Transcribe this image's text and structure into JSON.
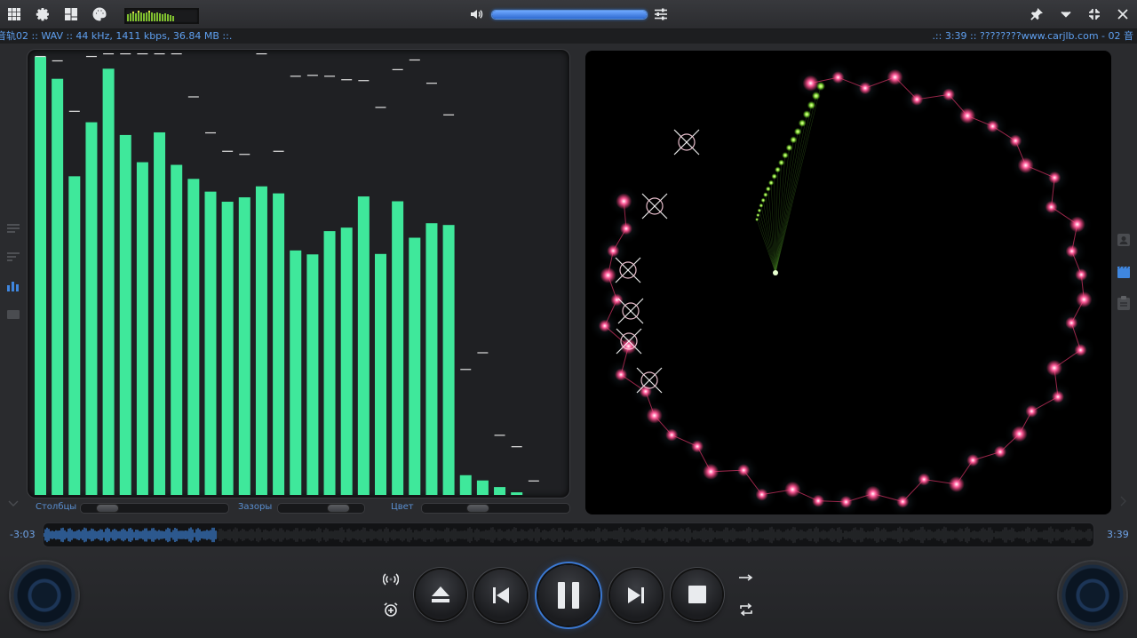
{
  "colors": {
    "accent": "#4a90e8",
    "spectrum_bar": "#3fe89b",
    "peak_marker": "#e0e0e0",
    "viz_ring": "#ff3d7a",
    "viz_tail": "#8be33c"
  },
  "toolbar": {
    "left_icons": [
      "apps-grid-icon",
      "settings-gear-icon",
      "layout-windows-icon",
      "palette-icon"
    ],
    "right_icons": [
      "pin-icon",
      "chevron-down-icon",
      "compact-mode-icon",
      "close-icon"
    ],
    "volume_level": 1.0
  },
  "info": {
    "left": "音轨02 :: WAV :: 44 kHz, 1411 kbps, 36.84 MB ::.",
    "right": ".:: 3:39 :: ????????www.carjlb.com - 02 音"
  },
  "spectrum": {
    "bars": [
      0.998,
      0.948,
      0.726,
      0.849,
      0.971,
      0.82,
      0.758,
      0.826,
      0.752,
      0.72,
      0.691,
      0.668,
      0.678,
      0.703,
      0.687,
      0.557,
      0.548,
      0.601,
      0.609,
      0.68,
      0.549,
      0.669,
      0.586,
      0.619,
      0.615,
      0.045,
      0.033,
      0.018,
      0.006
    ],
    "peaks": [
      0.992,
      0.982,
      0.867,
      0.992,
      0.998,
      0.998,
      0.998,
      0.998,
      0.998,
      0.9,
      0.818,
      0.776,
      0.769,
      0.998,
      0.776,
      0.947,
      0.949,
      0.947,
      0.939,
      0.937,
      0.876,
      0.962,
      0.984,
      0.931,
      0.859,
      0.279,
      0.317,
      0.129,
      0.103,
      0.025
    ]
  },
  "sliders": [
    {
      "label": "Столбцы",
      "value": 0.12
    },
    {
      "label": "Зазоры",
      "value": 0.78
    },
    {
      "label": "Цвет",
      "value": 0.36
    }
  ],
  "side_icons_left": [
    "playlist-icon",
    "queue-icon",
    "equalizer-icon",
    "video-icon"
  ],
  "side_icons_right": [
    "contact-icon",
    "video-clip-icon",
    "clipboard-icon"
  ],
  "transport": {
    "elapsed": "-3:03",
    "total": "3:39",
    "progress": 0.165
  },
  "controls": {
    "left_icons": [
      "broadcast-icon",
      "alarm-clock-icon"
    ],
    "main": [
      "eject-button",
      "previous-button",
      "pause-button",
      "next-button",
      "stop-button"
    ],
    "right_icons": [
      "play-order-icon",
      "repeat-icon"
    ]
  }
}
